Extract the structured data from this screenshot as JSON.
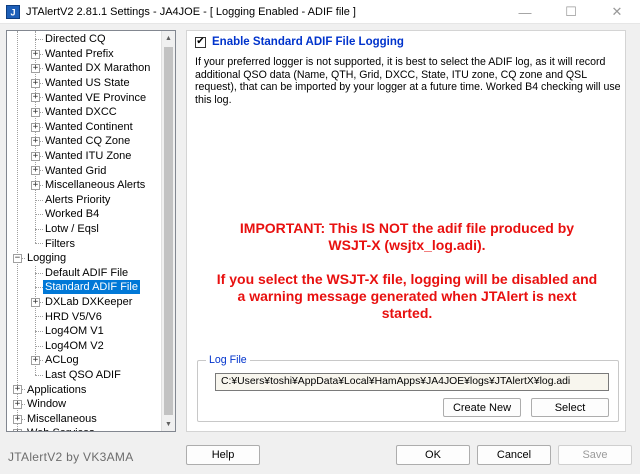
{
  "window": {
    "title": "JTAlertV2  2.81.1 Settings  -  JA4JOE  -  [ Logging Enabled - ADIF file ]",
    "minimize_glyph": "—",
    "maximize_glyph": "☐",
    "close_glyph": "✕",
    "app_icon": "jtalert-app-icon"
  },
  "tree": {
    "items": [
      {
        "label": "Directed CQ"
      },
      {
        "label": "Wanted Prefix"
      },
      {
        "label": "Wanted DX Marathon"
      },
      {
        "label": "Wanted US State"
      },
      {
        "label": "Wanted VE Province"
      },
      {
        "label": "Wanted DXCC"
      },
      {
        "label": "Wanted Continent"
      },
      {
        "label": "Wanted CQ Zone"
      },
      {
        "label": "Wanted ITU Zone"
      },
      {
        "label": "Wanted Grid"
      },
      {
        "label": "Miscellaneous Alerts"
      },
      {
        "label": "Alerts Priority"
      },
      {
        "label": "Worked B4"
      },
      {
        "label": "Lotw / Eqsl"
      },
      {
        "label": "Filters"
      },
      {
        "label": "Logging"
      },
      {
        "label": "Default ADIF File"
      },
      {
        "label": "Standard ADIF File"
      },
      {
        "label": "DXLab DXKeeper"
      },
      {
        "label": "HRD V5/V6"
      },
      {
        "label": "Log4OM V1"
      },
      {
        "label": "Log4OM V2"
      },
      {
        "label": "ACLog"
      },
      {
        "label": "Last QSO ADIF"
      },
      {
        "label": "Applications"
      },
      {
        "label": "Window"
      },
      {
        "label": "Miscellaneous"
      },
      {
        "label": "Web Services"
      }
    ],
    "expander_plus": "+",
    "expander_minus": "−"
  },
  "panel": {
    "enable_checked_glyph": "✔",
    "enable_label": "Enable Standard ADIF File Logging",
    "description": "If your preferred logger is not supported, it is best to select the ADIF log, as it will record additional QSO data (Name, QTH, Grid, DXCC, State, ITU zone, CQ zone and QSL request), that can be imported by your logger at a future time. Worked B4 checking will use this log.",
    "important_1": "IMPORTANT: This IS NOT the adif file produced by WSJT-X (wsjtx_log.adi).",
    "important_2": "If you select the WSJT-X file, logging will be disabled and a warning message generated when JTAlert is next started.",
    "log_file": {
      "legend": "Log File",
      "path": "C:¥Users¥toshi¥AppData¥Local¥HamApps¥JA4JOE¥logs¥JTAlertX¥log.adi",
      "create_new_label": "Create New",
      "select_label": "Select"
    }
  },
  "footer": {
    "brand": "JTAlertV2 by VK3AMA",
    "help_label": "Help",
    "ok_label": "OK",
    "cancel_label": "Cancel",
    "save_label": "Save"
  },
  "colors": {
    "accent_blue": "#0033cc",
    "important_red": "#e8100f",
    "selected_bg": "#0078d7"
  }
}
